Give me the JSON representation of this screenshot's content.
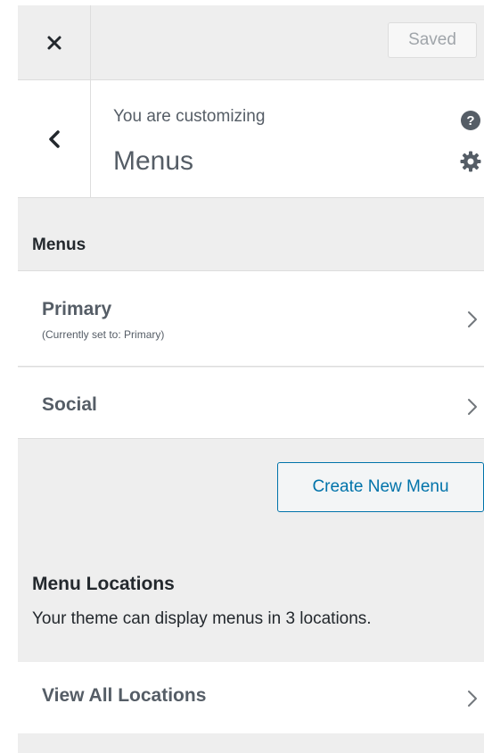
{
  "topbar": {
    "close_icon": "close-icon",
    "saved_label": "Saved"
  },
  "header": {
    "back_icon": "chevron-left-icon",
    "customizing_label": "You are customizing",
    "title": "Menus",
    "help_icon": "help-icon",
    "help_glyph": "?",
    "settings_icon": "gear-icon"
  },
  "menus_section": {
    "heading": "Menus",
    "items": [
      {
        "label": "Primary",
        "sublabel": "(Currently set to: Primary)"
      },
      {
        "label": "Social"
      }
    ],
    "create_button": "Create New Menu"
  },
  "locations_section": {
    "heading": "Menu Locations",
    "description": "Your theme can display menus in 3 locations.",
    "view_all": "View All Locations"
  },
  "colors": {
    "accent": "#0073aa",
    "panel_bg": "#eeeeee",
    "text": "#23282d",
    "muted": "#555d66"
  }
}
